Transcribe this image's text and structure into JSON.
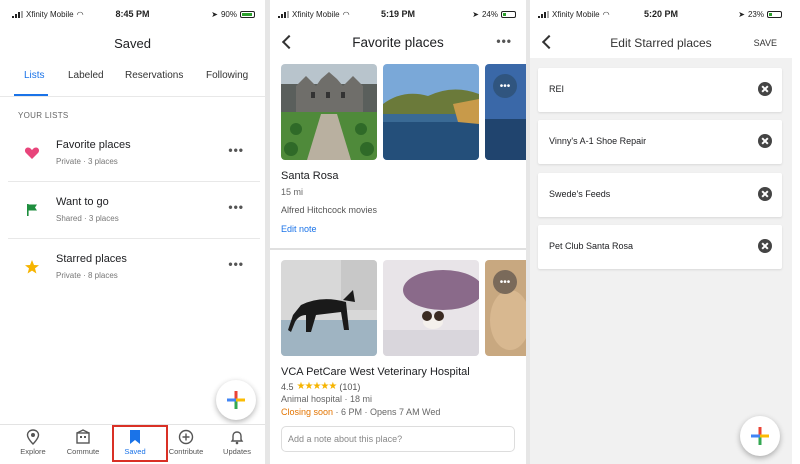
{
  "screen1": {
    "status": {
      "carrier": "Xfinity Mobile",
      "time": "8:45 PM",
      "battery": "90%"
    },
    "title": "Saved",
    "tabs": [
      "Lists",
      "Labeled",
      "Reservations",
      "Following"
    ],
    "section_label": "YOUR LISTS",
    "lists": [
      {
        "title": "Favorite places",
        "subtitle": "Private · 3 places",
        "icon": "heart-icon",
        "color": "#e8457b"
      },
      {
        "title": "Want to go",
        "subtitle": "Shared · 3 places",
        "icon": "flag-icon",
        "color": "#1e8e3e"
      },
      {
        "title": "Starred places",
        "subtitle": "Private · 8 places",
        "icon": "star-icon",
        "color": "#f6b400"
      }
    ],
    "nav": [
      "Explore",
      "Commute",
      "Saved",
      "Contribute",
      "Updates"
    ]
  },
  "screen2": {
    "status": {
      "carrier": "Xfinity Mobile",
      "time": "5:19 PM",
      "battery": "24%"
    },
    "title": "Favorite places",
    "place1": {
      "name": "Santa Rosa",
      "distance": "15 mi",
      "note": "Alfred Hitchcock movies",
      "edit": "Edit note"
    },
    "place2": {
      "name": "VCA PetCare West Veterinary Hospital",
      "rating": "4.5",
      "reviews": "(101)",
      "category": "Animal hospital · 18 mi",
      "closing": "Closing soon",
      "hours": " · 6 PM · Opens 7 AM Wed",
      "note_placeholder": "Add a note about this place?"
    }
  },
  "screen3": {
    "status": {
      "carrier": "Xfinity Mobile",
      "time": "5:20 PM",
      "battery": "23%"
    },
    "title": "Edit Starred places",
    "save": "SAVE",
    "items": [
      "REI",
      "Vinny's A-1 Shoe Repair",
      "Swede's Feeds",
      "Pet Club Santa Rosa"
    ]
  },
  "colors": {
    "accent": "#1a73e8",
    "highlight": "#d93025",
    "closing": "#e37400",
    "stars": "#f6b400"
  }
}
